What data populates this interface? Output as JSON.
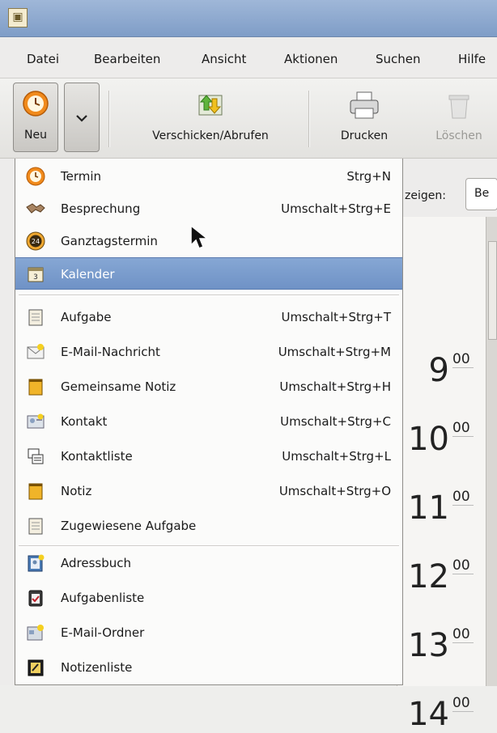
{
  "menubar": {
    "items": [
      "Datei",
      "Bearbeiten",
      "Ansicht",
      "Aktionen",
      "Suchen",
      "Hilfe"
    ]
  },
  "toolbar": {
    "new_label": "Neu",
    "send_receive_label": "Verschicken/Abrufen",
    "print_label": "Drucken",
    "delete_label": "Löschen"
  },
  "view": {
    "show_label": "zeigen:",
    "show_value": "Be"
  },
  "calendar": {
    "hours": [
      "9",
      "10",
      "11",
      "12",
      "13",
      "14"
    ],
    "minutes": "00"
  },
  "new_menu": {
    "highlighted": "Kalender",
    "group1": [
      {
        "label": "Termin",
        "accel": "Strg+N",
        "icon": "appointment-icon"
      },
      {
        "label": "Besprechung",
        "accel": "Umschalt+Strg+E",
        "icon": "meeting-icon"
      },
      {
        "label": "Ganztagstermin",
        "accel": "",
        "icon": "all-day-event-icon"
      },
      {
        "label": "Kalender",
        "accel": "",
        "icon": "calendar-icon"
      }
    ],
    "group2": [
      {
        "label": "Aufgabe",
        "accel": "Umschalt+Strg+T",
        "icon": "task-icon"
      },
      {
        "label": "E-Mail-Nachricht",
        "accel": "Umschalt+Strg+M",
        "icon": "mail-message-icon"
      },
      {
        "label": "Gemeinsame Notiz",
        "accel": "Umschalt+Strg+H",
        "icon": "shared-memo-icon"
      },
      {
        "label": "Kontakt",
        "accel": "Umschalt+Strg+C",
        "icon": "contact-icon"
      },
      {
        "label": "Kontaktliste",
        "accel": "Umschalt+Strg+L",
        "icon": "contact-list-icon"
      },
      {
        "label": "Notiz",
        "accel": "Umschalt+Strg+O",
        "icon": "memo-icon"
      },
      {
        "label": "Zugewiesene Aufgabe",
        "accel": "",
        "icon": "assigned-task-icon"
      }
    ],
    "group3": [
      {
        "label": "Adressbuch",
        "icon": "address-book-icon"
      },
      {
        "label": "Aufgabenliste",
        "icon": "task-list-icon"
      },
      {
        "label": "E-Mail-Ordner",
        "icon": "mail-folder-icon"
      },
      {
        "label": "Notizenliste",
        "icon": "memo-list-icon"
      }
    ]
  },
  "colors": {
    "highlight": "#7b9dcc",
    "titlebar": "#8aa7cf"
  }
}
